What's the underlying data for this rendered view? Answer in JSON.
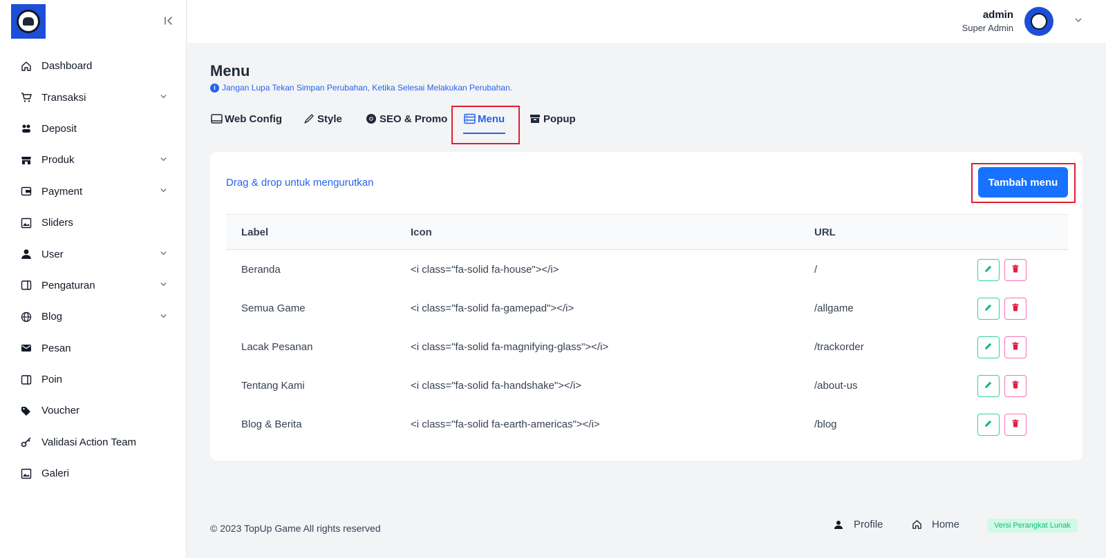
{
  "sidebar": {
    "items": [
      {
        "label": "Dashboard",
        "icon": "home-icon",
        "has_submenu": false
      },
      {
        "label": "Transaksi",
        "icon": "cart-icon",
        "has_submenu": true
      },
      {
        "label": "Deposit",
        "icon": "coins-icon",
        "has_submenu": false
      },
      {
        "label": "Produk",
        "icon": "store-icon",
        "has_submenu": true
      },
      {
        "label": "Payment",
        "icon": "wallet-icon",
        "has_submenu": true
      },
      {
        "label": "Sliders",
        "icon": "image-icon",
        "has_submenu": false
      },
      {
        "label": "User",
        "icon": "user-icon",
        "has_submenu": true
      },
      {
        "label": "Pengaturan",
        "icon": "panel-icon",
        "has_submenu": true
      },
      {
        "label": "Blog",
        "icon": "globe-icon",
        "has_submenu": true
      },
      {
        "label": "Pesan",
        "icon": "mail-icon",
        "has_submenu": false
      },
      {
        "label": "Poin",
        "icon": "panel-icon",
        "has_submenu": false
      },
      {
        "label": "Voucher",
        "icon": "tag-icon",
        "has_submenu": false
      },
      {
        "label": "Validasi Action Team",
        "icon": "key-icon",
        "has_submenu": false
      },
      {
        "label": "Galeri",
        "icon": "image-icon",
        "has_submenu": false
      }
    ]
  },
  "header": {
    "user_name": "admin",
    "user_role": "Super Admin"
  },
  "page": {
    "title": "Menu",
    "notice": "Jangan Lupa Tekan Simpan Perubahan, Ketika Selesai Melakukan Perubahan."
  },
  "tabs": [
    {
      "label": "Web Config",
      "icon": "window-icon",
      "active": false
    },
    {
      "label": "Style",
      "icon": "brush-icon",
      "active": false
    },
    {
      "label": "SEO & Promo",
      "icon": "chrome-icon",
      "active": false
    },
    {
      "label": "Menu",
      "icon": "menu-list-icon",
      "active": true
    },
    {
      "label": "Popup",
      "icon": "archive-icon",
      "active": false
    }
  ],
  "card": {
    "drag_hint": "Drag & drop untuk mengurutkan",
    "add_button": "Tambah menu"
  },
  "table": {
    "headers": {
      "label": "Label",
      "icon": "Icon",
      "url": "URL"
    },
    "rows": [
      {
        "label": "Beranda",
        "icon": "<i class=\"fa-solid fa-house\"></i>",
        "url": "/"
      },
      {
        "label": "Semua Game",
        "icon": "<i class=\"fa-solid fa-gamepad\"></i>",
        "url": "/allgame"
      },
      {
        "label": "Lacak Pesanan",
        "icon": "<i class=\"fa-solid fa-magnifying-glass\"></i>",
        "url": "/trackorder"
      },
      {
        "label": "Tentang Kami",
        "icon": "<i class=\"fa-solid fa-handshake\"></i>",
        "url": "/about-us"
      },
      {
        "label": "Blog & Berita",
        "icon": "<i class=\"fa-solid fa-earth-americas\"></i>",
        "url": "/blog"
      }
    ]
  },
  "footer": {
    "copyright": "© 2023 TopUp Game All rights reserved",
    "profile": "Profile",
    "home": "Home",
    "version": "Versi Perangkat Lunak"
  },
  "colors": {
    "primary": "#1672ff",
    "link": "#2563eb",
    "highlight": "#e11d2e",
    "edit": "#10b981",
    "delete": "#e11d48"
  }
}
